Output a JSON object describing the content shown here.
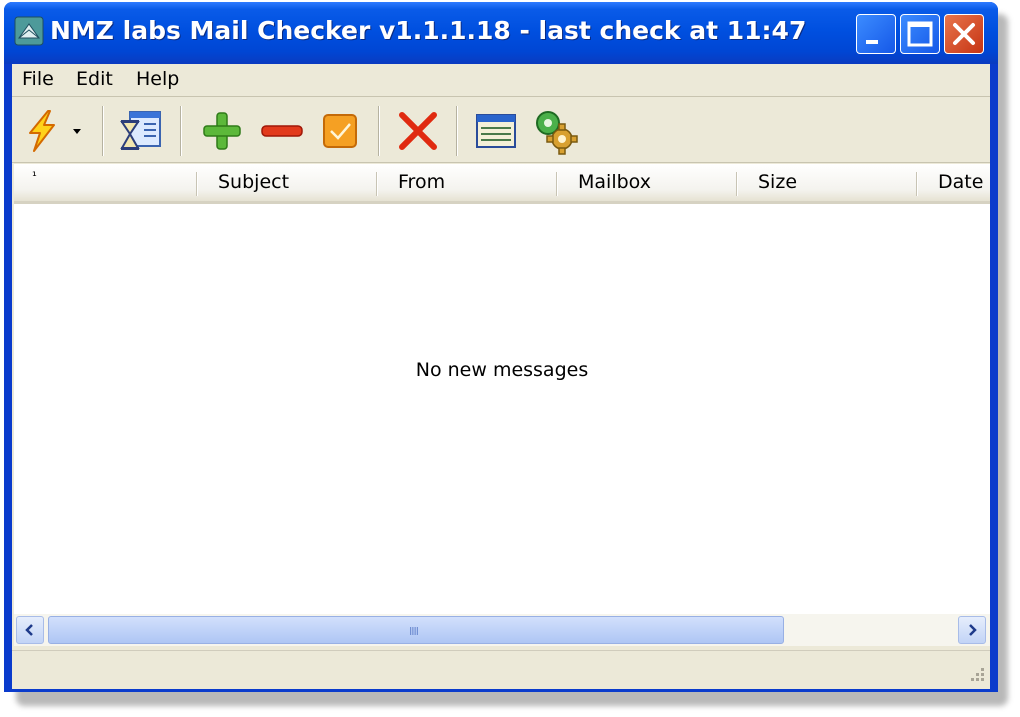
{
  "window": {
    "title": "NMZ labs Mail Checker v1.1.1.18 - last check at 11:47",
    "app_icon": "mail-checker-app-icon",
    "controls": [
      "minimize-icon",
      "maximize-icon",
      "close-icon"
    ]
  },
  "menu": {
    "items": [
      {
        "label": "File"
      },
      {
        "label": "Edit"
      },
      {
        "label": "Help"
      }
    ]
  },
  "toolbar": {
    "buttons": [
      {
        "icon": "lightning-check-mail-icon"
      },
      {
        "icon": "dropdown-arrow-icon"
      },
      {
        "icon": "hourglass-schedule-icon"
      },
      {
        "icon": "add-icon"
      },
      {
        "icon": "remove-icon"
      },
      {
        "icon": "checkbox-mark-icon"
      },
      {
        "icon": "delete-x-icon"
      },
      {
        "icon": "table-view-icon"
      },
      {
        "icon": "settings-gears-icon"
      }
    ]
  },
  "list": {
    "columns": [
      {
        "label": "¹"
      },
      {
        "label": "Subject"
      },
      {
        "label": "From"
      },
      {
        "label": "Mailbox"
      },
      {
        "label": "Size"
      },
      {
        "label": "Date"
      }
    ],
    "empty_text": "No new messages"
  },
  "scrollbar": {
    "grip": "IIII"
  },
  "colors": {
    "titlebar": "#0050e0",
    "close_button": "#c63414",
    "face": "#ece9d8"
  }
}
